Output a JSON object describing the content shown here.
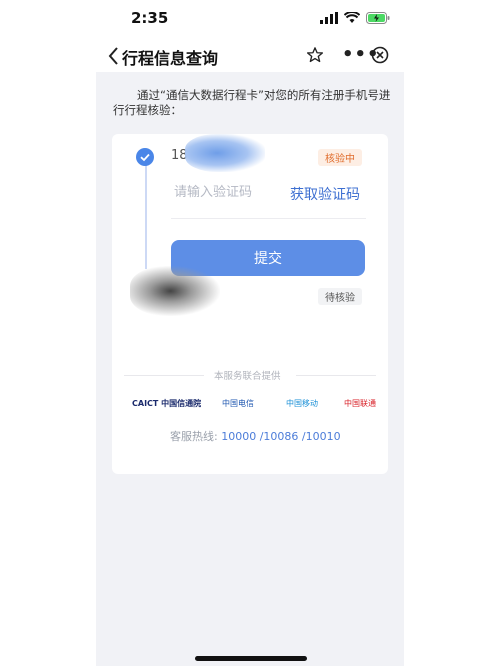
{
  "status_bar": {
    "time": "2:35"
  },
  "nav": {
    "title": "行程信息查询"
  },
  "description": "通过“通信大数据行程卡”对您的所有注册手机号进行行程核验：",
  "card": {
    "phone_partial": "18",
    "badge_verifying": "核验中",
    "code_placeholder": "请输入验证码",
    "get_code_label": "获取验证码",
    "submit_label": "提交",
    "badge_pending": "待核验",
    "provider_text": "本服务联合提供",
    "logos": {
      "caict": "CAICT 中国信通院",
      "telecom": "中国电信",
      "mobile": "中国移动",
      "unicom": "中国联通"
    },
    "hotline_label": "客服热线:",
    "hotline_1": "10000",
    "hotline_2": "/10086",
    "hotline_3": "/10010"
  },
  "colors": {
    "accent": "#5d8ee6",
    "link": "#3d6fd1",
    "warning": "#e06c2c"
  }
}
